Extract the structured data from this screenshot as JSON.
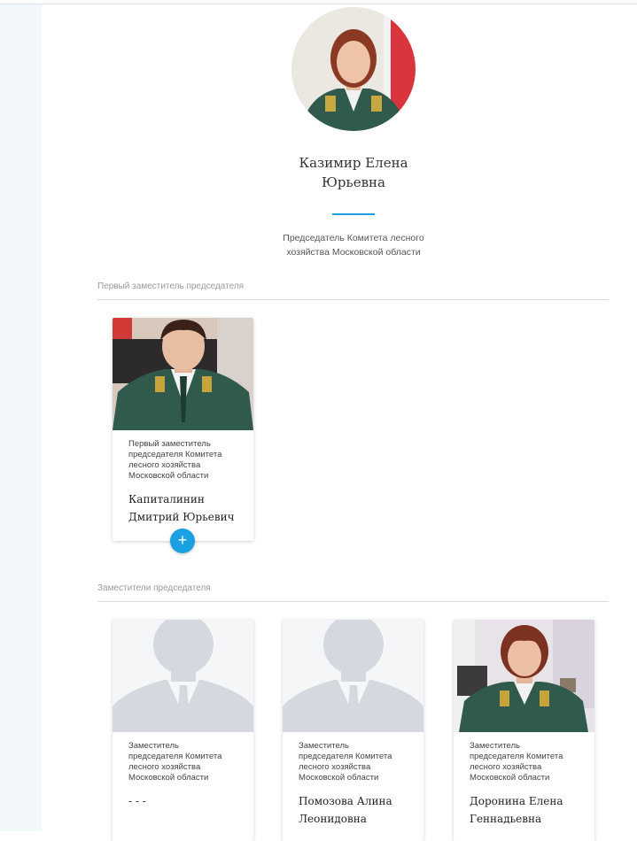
{
  "head": {
    "name_line1": "Казимир Елена",
    "name_line2": "Юрьевна",
    "position_line1": "Председатель Комитета лесного",
    "position_line2": "хозяйства Московской области"
  },
  "sections": {
    "first_deputy_title": "Первый заместитель председателя",
    "deputies_title": "Заместители председателя"
  },
  "first_deputy": {
    "position": [
      "Первый заместитель",
      "председателя Комитета",
      "лесного хозяйства",
      "Московской области"
    ],
    "name_line1": "Капиталинин",
    "name_line2": "Дмитрий Юрьевич",
    "expand_label": "+"
  },
  "deputies": [
    {
      "position": [
        "Заместитель",
        "председателя Комитета",
        "лесного хозяйства",
        "Московской области"
      ],
      "name_line1": "- - -",
      "name_line2": ""
    },
    {
      "position": [
        "Заместитель",
        "председателя Комитета",
        "лесного хозяйства",
        "Московской области"
      ],
      "name_line1": "Помозова Алина",
      "name_line2": "Леонидовна"
    },
    {
      "position": [
        "Заместитель",
        "председателя Комитета",
        "лесного хозяйства",
        "Московской области"
      ],
      "name_line1": "Доронина Елена",
      "name_line2": "Геннадьевна"
    }
  ],
  "colors": {
    "accent": "#1ba1e2",
    "sidebar": "#f2f7f9",
    "uniform": "#2f5a4c",
    "placeholder_bg": "#f5f6f8",
    "placeholder_silhouette": "#d5d9df"
  }
}
